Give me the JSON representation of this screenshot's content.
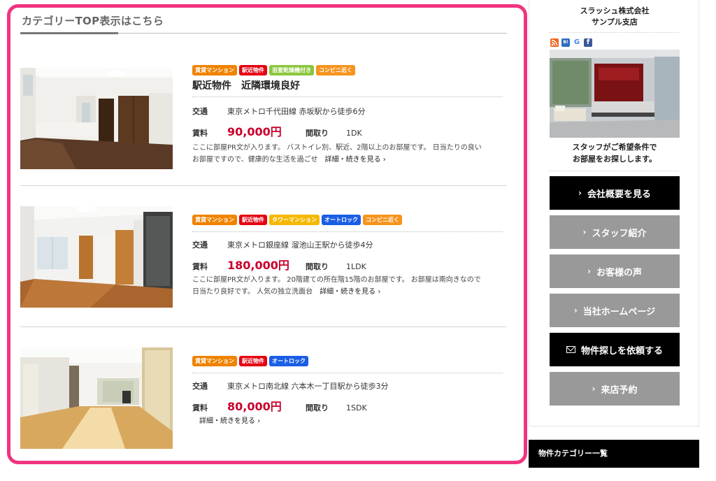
{
  "section_title": "カテゴリーTOP表示はこちら",
  "listings": [
    {
      "tags": [
        {
          "label": "賃貸マンション",
          "color": "orange"
        },
        {
          "label": "駅近物件",
          "color": "red"
        },
        {
          "label": "浴室乾燥機付き",
          "color": "green"
        },
        {
          "label": "コンビニ近く",
          "color": "amber"
        }
      ],
      "title": "駅近物件　近隣環境良好",
      "transit_label": "交通",
      "transit": "東京メトロ千代田線 赤坂駅から徒歩6分",
      "rent_label": "賃料",
      "rent": "90,000円",
      "layout_label": "間取り",
      "layout": "1DK",
      "desc_lines": [
        "ここに部屋PR文が入ります。 バストイレ別、駅近、2階以上のお部屋です。 日当たりの良い",
        "お部屋ですので、健康的な生活を過ごせ"
      ],
      "more": "詳細・続きを見る ›"
    },
    {
      "tags": [
        {
          "label": "賃貸マンション",
          "color": "orange"
        },
        {
          "label": "駅近物件",
          "color": "red"
        },
        {
          "label": "タワーマンション",
          "color": "yellow"
        },
        {
          "label": "オートロック",
          "color": "blue"
        },
        {
          "label": "コンビニ近く",
          "color": "amber"
        }
      ],
      "transit_label": "交通",
      "transit": "東京メトロ銀座線 溜池山王駅から徒歩4分",
      "rent_label": "賃料",
      "rent": "180,000円",
      "layout_label": "間取り",
      "layout": "1LDK",
      "desc_lines": [
        "ここに部屋PR文が入ります。 20階建ての所在階15階のお部屋です。 お部屋は南向きなので",
        "日当たり良好です。 人気の独立洗面台"
      ],
      "more": "詳細・続きを見る ›"
    },
    {
      "tags": [
        {
          "label": "賃貸マンション",
          "color": "orange"
        },
        {
          "label": "駅近物件",
          "color": "red"
        },
        {
          "label": "オートロック",
          "color": "blue"
        }
      ],
      "transit_label": "交通",
      "transit": "東京メトロ南北線 六本木一丁目駅から徒歩3分",
      "rent_label": "賃料",
      "rent": "80,000円",
      "layout_label": "間取り",
      "layout": "1SDK",
      "more": "詳細・続きを見る ›"
    }
  ],
  "sidebar": {
    "company_line1": "スラッシュ株式会社",
    "company_line2": "サンプル支店",
    "social": [
      {
        "icon": "rss-icon",
        "glyph": "",
        "color": "#f26522"
      },
      {
        "icon": "hatena-icon",
        "glyph": "B!",
        "color": "#2c6ebd"
      },
      {
        "icon": "google-icon",
        "glyph": "G",
        "color": "#ffffff"
      },
      {
        "icon": "facebook-icon",
        "glyph": "f",
        "color": "#3b5998"
      }
    ],
    "staff_line1": "スタッフがご希望条件で",
    "staff_line2": "お部屋をお探しします。",
    "buttons": [
      {
        "label": "会社概要を見る",
        "style": "black",
        "icon": "chevron"
      },
      {
        "label": "スタッフ紹介",
        "style": "gray",
        "icon": "chevron"
      },
      {
        "label": "お客様の声",
        "style": "gray",
        "icon": "chevron"
      },
      {
        "label": "当社ホームページ",
        "style": "gray",
        "icon": "chevron"
      },
      {
        "label": "物件探しを依頼する",
        "style": "black",
        "icon": "mail"
      },
      {
        "label": "来店予約",
        "style": "gray",
        "icon": "chevron"
      }
    ],
    "category_bar": "物件カテゴリー一覧"
  },
  "colors": {
    "highlight_border": "#f0347f",
    "price": "#c8002d",
    "button_black": "#000000",
    "button_gray": "#999999"
  }
}
